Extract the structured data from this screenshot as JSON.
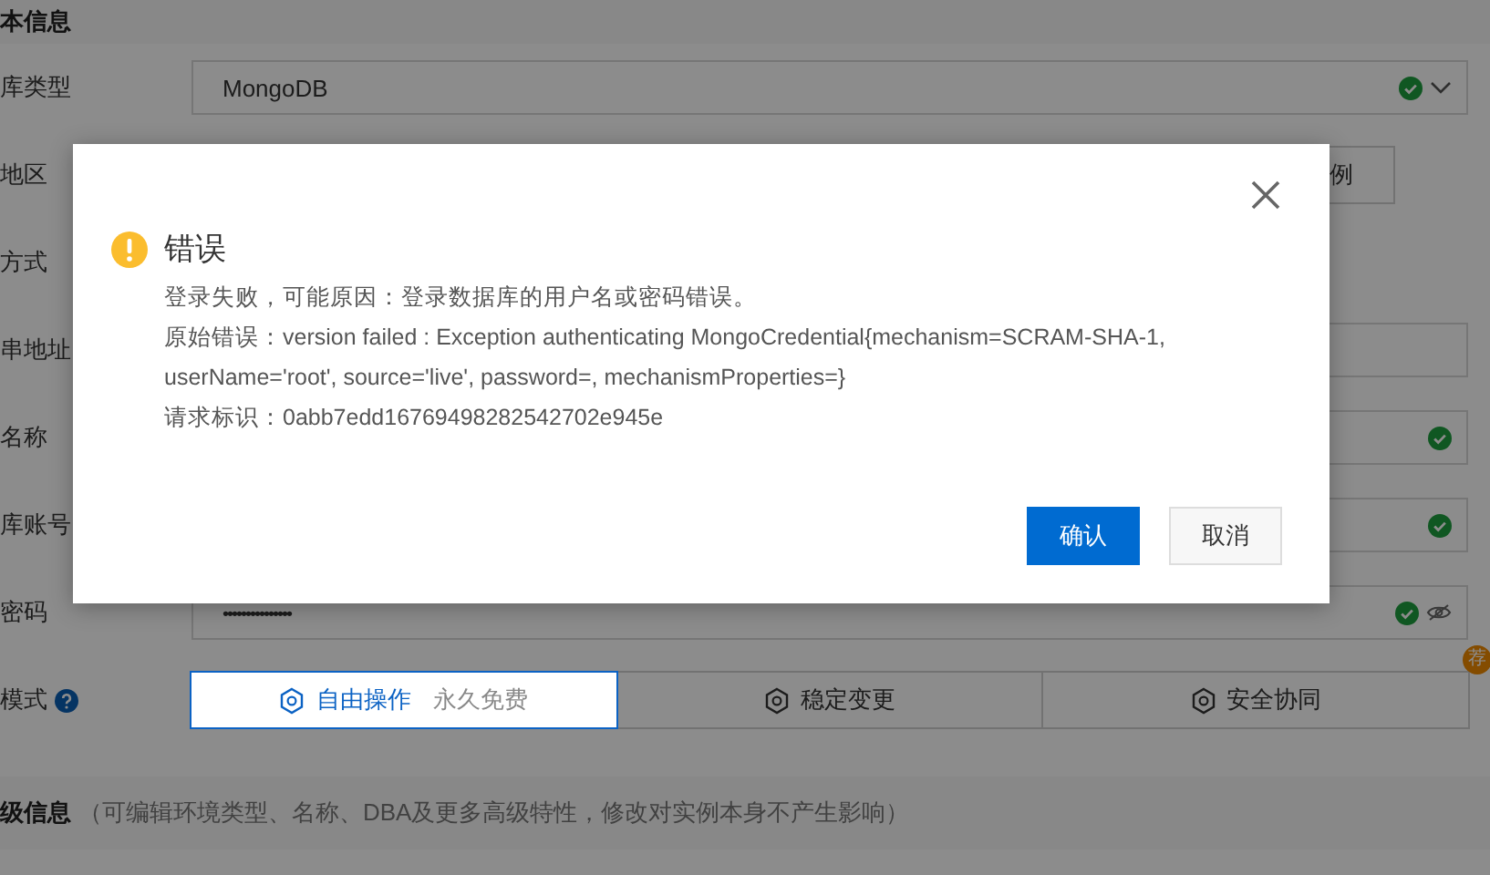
{
  "section_title": "本信息",
  "fields": [
    {
      "kind": "select",
      "label": "库类型",
      "value": "MongoDB",
      "valid": true
    },
    {
      "kind": "button",
      "label": "地区",
      "button": "例"
    },
    {
      "kind": "label",
      "label": "方式"
    },
    {
      "kind": "text",
      "label": "串地址"
    },
    {
      "kind": "text",
      "label": "名称",
      "valid": true
    },
    {
      "kind": "text",
      "label": "库账号",
      "valid": true
    },
    {
      "kind": "password",
      "label": "密码",
      "value": "•••••••••••••••",
      "valid": true
    },
    {
      "kind": "mode",
      "label": "模式",
      "options": [
        {
          "label": "自由操作",
          "note": "永久免费",
          "selected": true
        },
        {
          "label": "稳定变更",
          "selected": false
        },
        {
          "label": "安全协同",
          "selected": false,
          "badge": "荐"
        }
      ]
    }
  ],
  "advanced": {
    "title": "级信息",
    "note": "（可编辑环境类型、名称、DBA及更多高级特性，修改对实例本身不产生影响）"
  },
  "dialog": {
    "title": "错误",
    "lines": [
      "登录失败，可能原因：登录数据库的用户名或密码错误。",
      "原始错误：version failed : Exception authenticating MongoCredential{mechanism=SCRAM-SHA-1, userName='root', source='live', password=, mechanismProperties=}",
      "请求标识：0abb7edd16769498282542702e945e"
    ],
    "buttons": [
      {
        "label": "确认",
        "primary": true
      },
      {
        "label": "取消",
        "primary": false
      }
    ]
  }
}
